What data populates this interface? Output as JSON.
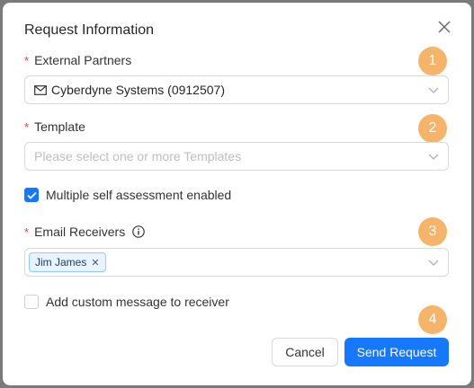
{
  "modal": {
    "title": "Request Information",
    "required_mark": "*",
    "external_partners": {
      "label": "External Partners",
      "value": "Cyberdyne Systems (0912507)"
    },
    "template": {
      "label": "Template",
      "placeholder": "Please select one or more Templates"
    },
    "multiple_self_assessment": {
      "label": "Multiple self assessment enabled",
      "checked": true
    },
    "email_receivers": {
      "label": "Email Receivers",
      "tags": [
        "Jim James"
      ]
    },
    "custom_message": {
      "label": "Add custom message to receiver",
      "checked": false
    },
    "buttons": {
      "cancel": "Cancel",
      "send": "Send Request"
    }
  },
  "step_badges": [
    "1",
    "2",
    "3",
    "4"
  ],
  "colors": {
    "primary": "#1677ff",
    "badge": "#f5b46a",
    "required": "#e8413c"
  }
}
